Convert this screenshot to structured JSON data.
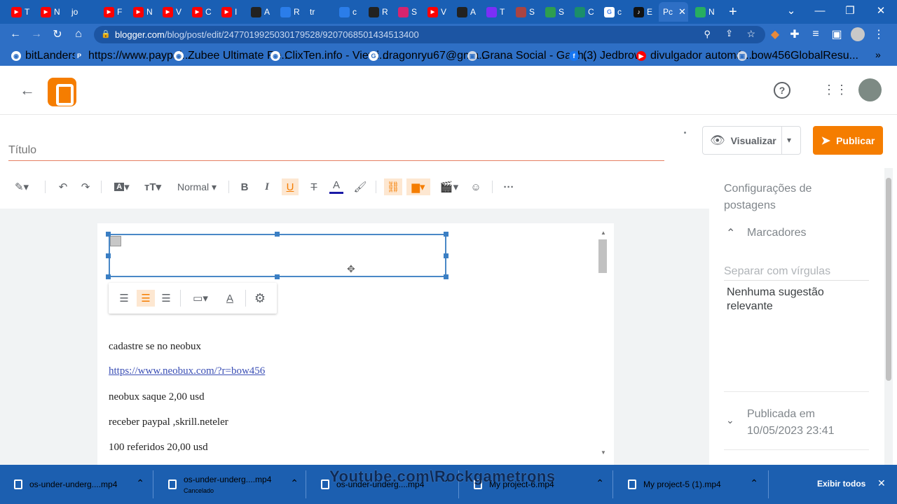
{
  "browser": {
    "tabs": [
      {
        "favicon": "youtube-icon",
        "color": "#ff0000",
        "label": "T"
      },
      {
        "favicon": "youtube-icon",
        "color": "#ff0000",
        "label": "N"
      },
      {
        "favicon": "text",
        "color": "#1a5fb4",
        "label": "jo"
      },
      {
        "favicon": "youtube-icon",
        "color": "#ff0000",
        "label": "F"
      },
      {
        "favicon": "youtube-icon",
        "color": "#ff0000",
        "label": "N"
      },
      {
        "favicon": "youtube-icon",
        "color": "#ff0000",
        "label": "V"
      },
      {
        "favicon": "youtube-icon",
        "color": "#ff0000",
        "label": "C"
      },
      {
        "favicon": "youtube-icon",
        "color": "#ff0000",
        "label": "I"
      },
      {
        "favicon": "generic",
        "color": "#222222",
        "label": "A"
      },
      {
        "favicon": "generic",
        "color": "#2b7de9",
        "label": "R"
      },
      {
        "favicon": "text",
        "color": "#1a5fb4",
        "label": "tr"
      },
      {
        "favicon": "generic",
        "color": "#2b7de9",
        "label": "c"
      },
      {
        "favicon": "generic",
        "color": "#222222",
        "label": "R"
      },
      {
        "favicon": "generic",
        "color": "#d6246e",
        "label": "S"
      },
      {
        "favicon": "youtube-icon",
        "color": "#ff0000",
        "label": "V"
      },
      {
        "favicon": "generic",
        "color": "#222222",
        "label": "A"
      },
      {
        "favicon": "generic",
        "color": "#7b2ff7",
        "label": "T"
      },
      {
        "favicon": "generic",
        "color": "#a94442",
        "label": "S"
      },
      {
        "favicon": "generic",
        "color": "#2e9e4f",
        "label": "S"
      },
      {
        "favicon": "generic",
        "color": "#1b8e6a",
        "label": "C"
      },
      {
        "favicon": "google-icon",
        "color": "#ffffff",
        "label": "c"
      },
      {
        "favicon": "tiktok-icon",
        "color": "#111111",
        "label": "E"
      },
      {
        "favicon": "text",
        "color": "#2e6fc5",
        "label": "Pc",
        "active": true
      },
      {
        "favicon": "generic",
        "color": "#27ae60",
        "label": "N"
      }
    ],
    "new_tab": "+",
    "url_host": "blogger.com",
    "url_path": "/blog/post/edit/2477019925030179528/9207068501434513400",
    "bookmarks": [
      {
        "icon": "globe-icon",
        "label": "bitLanders"
      },
      {
        "icon": "paypal-icon",
        "label": "https://www.paypal..."
      },
      {
        "icon": "globe-icon",
        "label": "Zubee Ultimate Re..."
      },
      {
        "icon": "globe-icon",
        "label": "ClixTen.info - Viewi..."
      },
      {
        "icon": "google-icon",
        "label": "dragonryu67@gma..."
      },
      {
        "icon": "site-icon",
        "label": "Grana Social - Ganh..."
      },
      {
        "icon": "facebook-icon",
        "label": "(3) Jedbrow"
      },
      {
        "icon": "youtube-icon",
        "label": "divulgador automát..."
      },
      {
        "icon": "site-icon",
        "label": "bow456GlobalResu..."
      }
    ],
    "bookmarks_more": "»"
  },
  "editor": {
    "title_placeholder": "Título",
    "preview_label": "Visualizar",
    "publish_label": "Publicar",
    "paragraph_style": "Normal",
    "body_lines": [
      {
        "text": "cadastre se no neobux",
        "link": false
      },
      {
        "text": "https://www.neobux.com/?r=bow456",
        "link": true
      },
      {
        "text": "neobux saque 2,00 usd",
        "link": false
      },
      {
        "text": "receber paypal ,skrill.neteler",
        "link": false
      },
      {
        "text": "100 referidos 20,00 usd",
        "link": false
      }
    ]
  },
  "sidebar": {
    "heading_line1": "Configurações de",
    "heading_line2": "postagens",
    "labels_title": "Marcadores",
    "labels_placeholder": "Separar com vírgulas",
    "no_suggestion_line1": "Nenhuma sugestão",
    "no_suggestion_line2": "relevante",
    "published_line1": "Publicada em",
    "published_line2": "10/05/2023 23:41"
  },
  "downloads": {
    "items": [
      {
        "name": "os-under-underg....mp4",
        "status": ""
      },
      {
        "name": "os-under-underg....mp4",
        "status": "Cancelado"
      },
      {
        "name": "os-under-underg....mp4",
        "status": ""
      },
      {
        "name": "My project-6.mp4",
        "status": ""
      },
      {
        "name": "My project-5 (1).mp4",
        "status": ""
      }
    ],
    "show_all": "Exibir todos"
  },
  "watermark": "Youtube.com\\Rockgametrons",
  "colors": {
    "blogger_orange": "#f57d00",
    "browser_blue": "#1a5fb4",
    "link": "#3b4fb5"
  }
}
